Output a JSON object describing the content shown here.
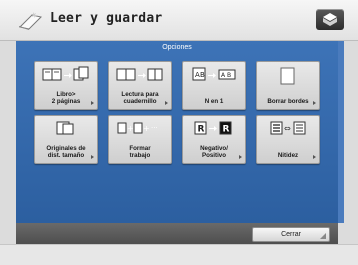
{
  "header": {
    "title": "Leer y guardar",
    "logo_icon": "scan-save-icon",
    "menu_icon": "menu-icon"
  },
  "panel": {
    "title": "Opciones",
    "background": "#3d73b7"
  },
  "options": [
    {
      "label": "Libro>\n2 páginas",
      "icon": "book-to-two-pages-icon"
    },
    {
      "label": "Lectura para\ncuadernillo",
      "icon": "booklet-scan-icon"
    },
    {
      "label": "N en 1",
      "icon": "n-on-1-icon"
    },
    {
      "label": "Borrar bordes",
      "icon": "erase-frame-icon"
    },
    {
      "label": "Originales de\ndist. tamaño",
      "icon": "different-size-originals-icon"
    },
    {
      "label": "Formar\ntrabajo",
      "icon": "job-build-icon"
    },
    {
      "label": "Negativo/\nPositivo",
      "icon": "negative-positive-icon"
    },
    {
      "label": "Nitidez",
      "icon": "sharpness-icon"
    }
  ],
  "footer": {
    "close_label": "Cerrar"
  }
}
